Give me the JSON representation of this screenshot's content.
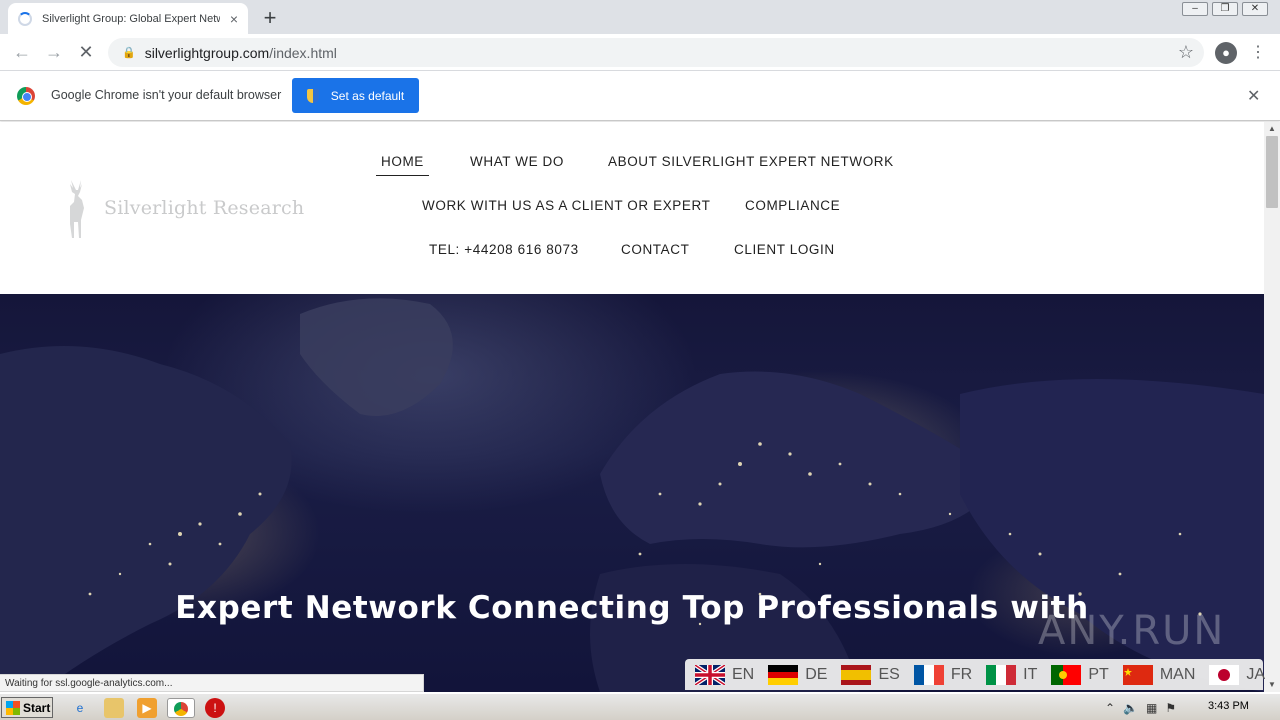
{
  "browser": {
    "tab_title": "Silverlight Group: Global Expert Netw",
    "tab_close": "×",
    "new_tab": "+",
    "url_host": "silverlightgroup.com",
    "url_path": "/index.html",
    "back": "←",
    "forward": "→",
    "reload": "✕",
    "star": "☆",
    "menu": "⋮",
    "window_controls": [
      "–",
      "❐",
      "✕"
    ]
  },
  "infobar": {
    "message": "Google Chrome isn't your default browser",
    "button": "Set as default",
    "close": "✕"
  },
  "site": {
    "brand": "Silverlight Research",
    "nav": {
      "home": "HOME",
      "what_we_do": "WHAT WE DO",
      "about": "ABOUT SILVERLIGHT EXPERT NETWORK",
      "work_with_us": "WORK WITH US AS A CLIENT OR EXPERT",
      "compliance": "COMPLIANCE",
      "tel": "TEL: +44208 616 8073",
      "contact": "CONTACT",
      "client_login": "CLIENT LOGIN"
    },
    "hero_title": "Expert Network Connecting Top Professionals with",
    "languages": [
      {
        "code": "EN"
      },
      {
        "code": "DE"
      },
      {
        "code": "ES"
      },
      {
        "code": "FR"
      },
      {
        "code": "IT"
      },
      {
        "code": "PT"
      },
      {
        "code": "MAN"
      },
      {
        "code": "JA"
      }
    ]
  },
  "status_text": "Waiting for ssl.google-analytics.com...",
  "watermark": "ANY.RUN",
  "taskbar": {
    "start": "Start",
    "clock": "3:43 PM"
  },
  "colors": {
    "chrome_blue": "#1a73e8",
    "hero_bg": "#15163a"
  }
}
